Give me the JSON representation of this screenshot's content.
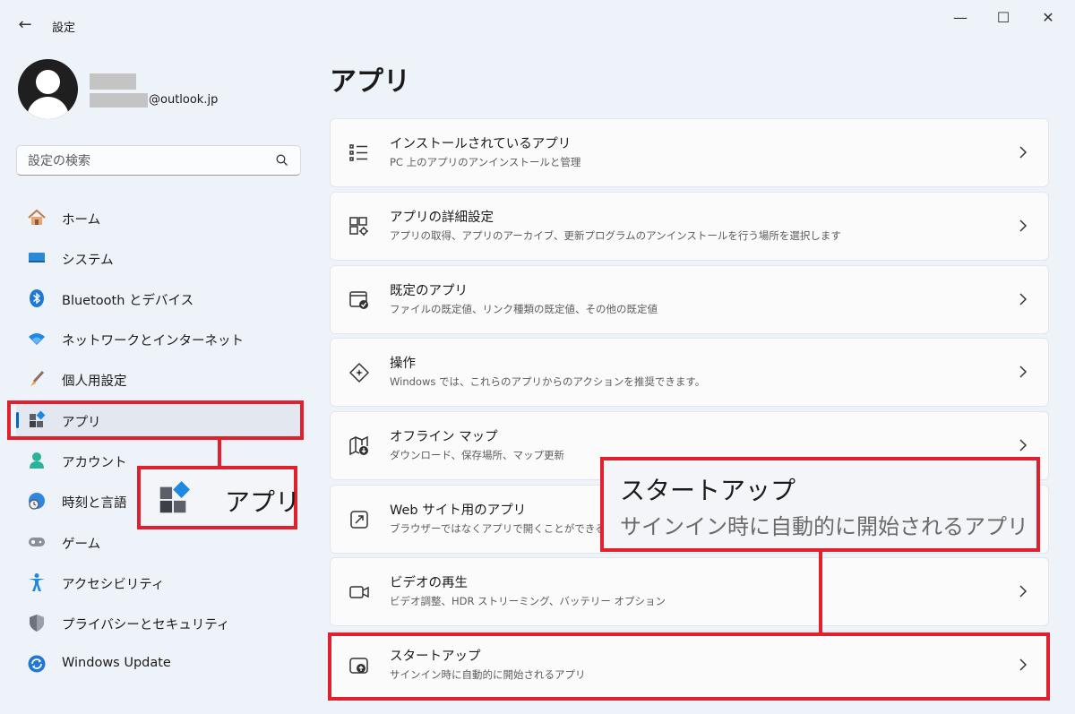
{
  "window": {
    "title": "設定",
    "back": "←",
    "minimize": "—",
    "maximize": "☐",
    "close": "✕"
  },
  "profile": {
    "email_suffix": "@outlook.jp"
  },
  "search": {
    "placeholder": "設定の検索"
  },
  "sidebar": {
    "items": [
      {
        "label": "ホーム",
        "icon": "home-icon"
      },
      {
        "label": "システム",
        "icon": "system-icon"
      },
      {
        "label": "Bluetooth とデバイス",
        "icon": "bluetooth-icon"
      },
      {
        "label": "ネットワークとインターネット",
        "icon": "wifi-icon"
      },
      {
        "label": "個人用設定",
        "icon": "brush-icon"
      },
      {
        "label": "アプリ",
        "icon": "apps-icon",
        "selected": true
      },
      {
        "label": "アカウント",
        "icon": "account-icon"
      },
      {
        "label": "時刻と言語",
        "icon": "globe-clock-icon"
      },
      {
        "label": "ゲーム",
        "icon": "gamepad-icon"
      },
      {
        "label": "アクセシビリティ",
        "icon": "accessibility-icon"
      },
      {
        "label": "プライバシーとセキュリティ",
        "icon": "shield-icon"
      },
      {
        "label": "Windows Update",
        "icon": "windows-update-icon"
      }
    ]
  },
  "main": {
    "title": "アプリ",
    "cards": [
      {
        "title": "インストールされているアプリ",
        "subtitle": "PC 上のアプリのアンインストールと管理",
        "icon": "installed-apps-icon"
      },
      {
        "title": "アプリの詳細設定",
        "subtitle": "アプリの取得、アプリのアーカイブ、更新プログラムのアンインストールを行う場所を選択します",
        "icon": "advanced-apps-icon"
      },
      {
        "title": "既定のアプリ",
        "subtitle": "ファイルの既定値、リンク種類の既定値、その他の既定値",
        "icon": "default-apps-icon"
      },
      {
        "title": "操作",
        "subtitle": "Windows では、これらのアプリからのアクションを推奨できます。",
        "icon": "actions-icon"
      },
      {
        "title": "オフライン マップ",
        "subtitle": "ダウンロード、保存場所、マップ更新",
        "icon": "offline-maps-icon"
      },
      {
        "title": "Web サイト用のアプリ",
        "subtitle": "ブラウザーではなくアプリで開くことができる we",
        "icon": "web-apps-icon"
      },
      {
        "title": "ビデオの再生",
        "subtitle": "ビデオ調整、HDR ストリーミング、バッテリー オプション",
        "icon": "video-playback-icon"
      },
      {
        "title": "スタートアップ",
        "subtitle": "サインイン時に自動的に開始されるアプリ",
        "icon": "startup-icon"
      }
    ]
  },
  "callouts": {
    "apps_label": "アプリ",
    "startup_title": "スタートアップ",
    "startup_subtitle": "サインイン時に自動的に開始されるアプリ"
  },
  "colors": {
    "highlight": "#e0202c",
    "accent": "#0067c0",
    "background": "#eef2f9"
  }
}
